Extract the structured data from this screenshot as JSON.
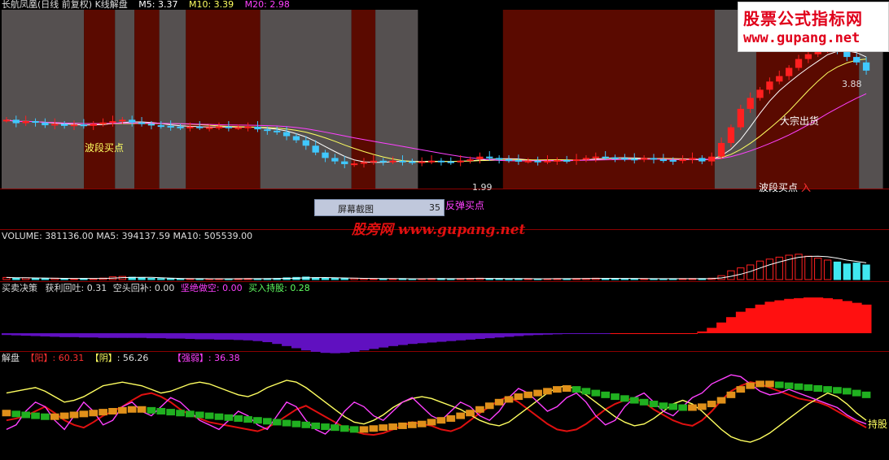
{
  "header": {
    "title": "长航凤凰(日线 前复权) K线解盘",
    "ma5": "M5: 3.37",
    "ma10": "M10: 3.39",
    "ma20": "M20: 2.98"
  },
  "tooltip": {
    "label": "屏幕截图",
    "value": "35"
  },
  "watermark": {
    "site_cn": "股票公式指标网",
    "site_url": "www.gupang.net",
    "overlay": "股旁网 www.gupang.net"
  },
  "colors": {
    "up": "#ff2020",
    "down": "#40c8ff",
    "ma5": "#ffffff",
    "ma10": "#ffff60",
    "ma20": "#ff40ff",
    "zone_red": "#5a0a00",
    "zone_gray": "#555050",
    "purple": "#6010c0",
    "sep": "#8b0000"
  },
  "chart_data": [
    {
      "type": "candlestick",
      "panel": "price",
      "annotations": [
        "波段买点",
        "反弹买点",
        "波段买点",
        "大宗出货",
        "入"
      ],
      "price_labels": {
        "high": "3.88",
        "low": "1.99"
      },
      "zones": [
        {
          "from": 0.0,
          "to": 0.093,
          "color": "gray"
        },
        {
          "from": 0.093,
          "to": 0.128,
          "color": "red"
        },
        {
          "from": 0.128,
          "to": 0.15,
          "color": "gray"
        },
        {
          "from": 0.15,
          "to": 0.178,
          "color": "red"
        },
        {
          "from": 0.178,
          "to": 0.208,
          "color": "gray"
        },
        {
          "from": 0.208,
          "to": 0.292,
          "color": "red"
        },
        {
          "from": 0.292,
          "to": 0.395,
          "color": "gray"
        },
        {
          "from": 0.395,
          "to": 0.422,
          "color": "red"
        },
        {
          "from": 0.422,
          "to": 0.47,
          "color": "gray"
        },
        {
          "from": 0.566,
          "to": 0.805,
          "color": "red"
        },
        {
          "from": 0.805,
          "to": 0.852,
          "color": "gray"
        },
        {
          "from": 0.852,
          "to": 0.968,
          "color": "red"
        },
        {
          "from": 0.968,
          "to": 0.995,
          "color": "gray"
        }
      ],
      "close": [
        2.66,
        2.61,
        2.64,
        2.62,
        2.58,
        2.6,
        2.57,
        2.59,
        2.57,
        2.6,
        2.62,
        2.64,
        2.66,
        2.62,
        2.6,
        2.58,
        2.57,
        2.56,
        2.55,
        2.56,
        2.55,
        2.55,
        2.56,
        2.55,
        2.55,
        2.56,
        2.52,
        2.5,
        2.48,
        2.42,
        2.36,
        2.28,
        2.18,
        2.1,
        2.05,
        2.01,
        2.02,
        2.04,
        2.06,
        2.05,
        2.06,
        2.05,
        2.04,
        2.05,
        2.06,
        2.05,
        2.04,
        2.06,
        2.08,
        2.12,
        2.1,
        2.08,
        2.07,
        2.06,
        2.06,
        2.05,
        2.06,
        2.07,
        2.06,
        2.08,
        2.1,
        2.12,
        2.11,
        2.1,
        2.09,
        2.08,
        2.1,
        2.08,
        2.07,
        2.06,
        2.08,
        2.1,
        2.05,
        2.12,
        2.32,
        2.55,
        2.82,
        2.98,
        3.1,
        3.22,
        3.3,
        3.42,
        3.55,
        3.62,
        3.7,
        3.78,
        3.66,
        3.58,
        3.5,
        3.38
      ],
      "ma_series": [
        {
          "name": "M5"
        },
        {
          "name": "M10"
        },
        {
          "name": "M20"
        }
      ]
    },
    {
      "type": "bar",
      "panel": "volume",
      "title": "VOLUME: 381136.00",
      "ma5": "MA5: 394137.59",
      "ma10": "MA10: 505539.00",
      "values": [
        22,
        15,
        18,
        12,
        10,
        14,
        11,
        9,
        12,
        10,
        15,
        28,
        32,
        24,
        18,
        12,
        10,
        9,
        8,
        10,
        9,
        8,
        9,
        8,
        10,
        11,
        9,
        10,
        12,
        18,
        22,
        26,
        20,
        16,
        12,
        10,
        14,
        11,
        9,
        8,
        9,
        10,
        8,
        9,
        10,
        11,
        9,
        10,
        12,
        14,
        10,
        9,
        8,
        9,
        10,
        8,
        9,
        10,
        9,
        11,
        12,
        14,
        12,
        11,
        10,
        9,
        10,
        9,
        8,
        9,
        10,
        11,
        10,
        14,
        40,
        90,
        120,
        150,
        190,
        210,
        230,
        250,
        260,
        240,
        220,
        200,
        180,
        160,
        170,
        150
      ],
      "ylim": [
        0,
        400
      ]
    },
    {
      "type": "area",
      "panel": "decision",
      "title": "买卖决策",
      "labels": [
        {
          "key": "获利回吐",
          "value": "0.31"
        },
        {
          "key": "空头回补",
          "value": "0.00"
        },
        {
          "key": "坚绝做空",
          "value": "0.00"
        },
        {
          "key": "买入持股",
          "value": "0.28"
        }
      ],
      "values": [
        -0.05,
        -0.06,
        -0.07,
        -0.08,
        -0.09,
        -0.1,
        -0.11,
        -0.11,
        -0.12,
        -0.12,
        -0.13,
        -0.13,
        -0.13,
        -0.13,
        -0.13,
        -0.14,
        -0.14,
        -0.15,
        -0.15,
        -0.16,
        -0.17,
        -0.17,
        -0.18,
        -0.18,
        -0.19,
        -0.2,
        -0.22,
        -0.25,
        -0.3,
        -0.36,
        -0.42,
        -0.48,
        -0.52,
        -0.55,
        -0.56,
        -0.55,
        -0.52,
        -0.48,
        -0.44,
        -0.4,
        -0.36,
        -0.33,
        -0.3,
        -0.28,
        -0.26,
        -0.24,
        -0.22,
        -0.2,
        -0.18,
        -0.16,
        -0.14,
        -0.12,
        -0.1,
        -0.08,
        -0.06,
        -0.05,
        -0.04,
        -0.03,
        -0.02,
        -0.02,
        -0.01,
        -0.01,
        -0.01,
        0.0,
        0.0,
        0.0,
        0.0,
        0.0,
        0.0,
        0.0,
        0.0,
        0.0,
        0.05,
        0.15,
        0.3,
        0.45,
        0.6,
        0.7,
        0.8,
        0.88,
        0.92,
        0.96,
        0.98,
        1.0,
        1.0,
        0.98,
        0.95,
        0.9,
        0.85,
        0.8
      ]
    },
    {
      "type": "line",
      "panel": "jiepan",
      "title": "解盘",
      "labels": [
        {
          "key": "【阳】",
          "value": "60.31"
        },
        {
          "key": "【阴】",
          "value": "56.26"
        },
        {
          "key": "【强弱】",
          "value": "36.38"
        }
      ],
      "bottom_label": "持股",
      "series": [
        {
          "name": "【阳】",
          "values": [
            40,
            42,
            45,
            50,
            55,
            48,
            40,
            35,
            32,
            38,
            45,
            50,
            55,
            62,
            68,
            70,
            66,
            60,
            52,
            46,
            42,
            38,
            36,
            34,
            32,
            30,
            28,
            32,
            38,
            45,
            52,
            56,
            50,
            44,
            38,
            32,
            28,
            25,
            24,
            26,
            30,
            34,
            38,
            36,
            34,
            30,
            28,
            32,
            40,
            48,
            55,
            62,
            66,
            60,
            52,
            44,
            36,
            30,
            28,
            30,
            36,
            44,
            52,
            58,
            62,
            64,
            60,
            52,
            46,
            40,
            36,
            34,
            40,
            50,
            62,
            72,
            78,
            82,
            80,
            76,
            72,
            68,
            64,
            62,
            60,
            56,
            50,
            44,
            38,
            32
          ]
        },
        {
          "name": "【阴】",
          "values": [
            70,
            72,
            74,
            76,
            72,
            66,
            60,
            62,
            66,
            72,
            78,
            80,
            82,
            80,
            78,
            74,
            70,
            72,
            76,
            80,
            82,
            80,
            76,
            72,
            68,
            66,
            70,
            76,
            80,
            84,
            82,
            76,
            68,
            60,
            52,
            44,
            38,
            36,
            40,
            46,
            54,
            60,
            64,
            66,
            64,
            60,
            56,
            52,
            46,
            40,
            36,
            34,
            38,
            46,
            54,
            62,
            70,
            76,
            78,
            74,
            68,
            60,
            52,
            44,
            38,
            34,
            36,
            42,
            50,
            58,
            62,
            58,
            50,
            40,
            30,
            22,
            18,
            16,
            20,
            26,
            34,
            42,
            50,
            58,
            64,
            70,
            66,
            58,
            48,
            40
          ]
        },
        {
          "name": "【强弱】",
          "values": [
            30,
            35,
            50,
            60,
            55,
            40,
            30,
            45,
            60,
            50,
            35,
            40,
            55,
            60,
            50,
            45,
            55,
            65,
            60,
            50,
            40,
            35,
            30,
            40,
            50,
            45,
            35,
            30,
            45,
            60,
            55,
            40,
            30,
            25,
            35,
            50,
            60,
            55,
            45,
            40,
            50,
            60,
            65,
            55,
            45,
            40,
            50,
            60,
            55,
            45,
            40,
            50,
            65,
            75,
            70,
            60,
            50,
            55,
            65,
            70,
            60,
            45,
            35,
            40,
            55,
            65,
            70,
            60,
            50,
            45,
            55,
            65,
            70,
            80,
            85,
            90,
            88,
            80,
            72,
            68,
            70,
            74,
            70,
            66,
            62,
            58,
            54,
            46,
            40,
            36
          ]
        },
        {
          "name": "trend",
          "values": [
            48,
            47,
            46,
            45,
            44,
            44,
            45,
            46,
            47,
            48,
            49,
            50,
            51,
            52,
            52,
            51,
            50,
            49,
            48,
            47,
            46,
            45,
            44,
            43,
            42,
            41,
            40,
            39,
            38,
            37,
            36,
            35,
            34,
            33,
            32,
            31,
            30,
            30,
            31,
            32,
            33,
            34,
            35,
            36,
            38,
            40,
            42,
            45,
            48,
            52,
            56,
            60,
            63,
            66,
            68,
            70,
            72,
            74,
            75,
            74,
            72,
            70,
            68,
            66,
            64,
            62,
            60,
            58,
            56,
            55,
            54,
            54,
            55,
            58,
            62,
            68,
            74,
            78,
            80,
            80,
            79,
            78,
            77,
            76,
            75,
            74,
            73,
            72,
            70,
            68
          ]
        }
      ]
    }
  ]
}
